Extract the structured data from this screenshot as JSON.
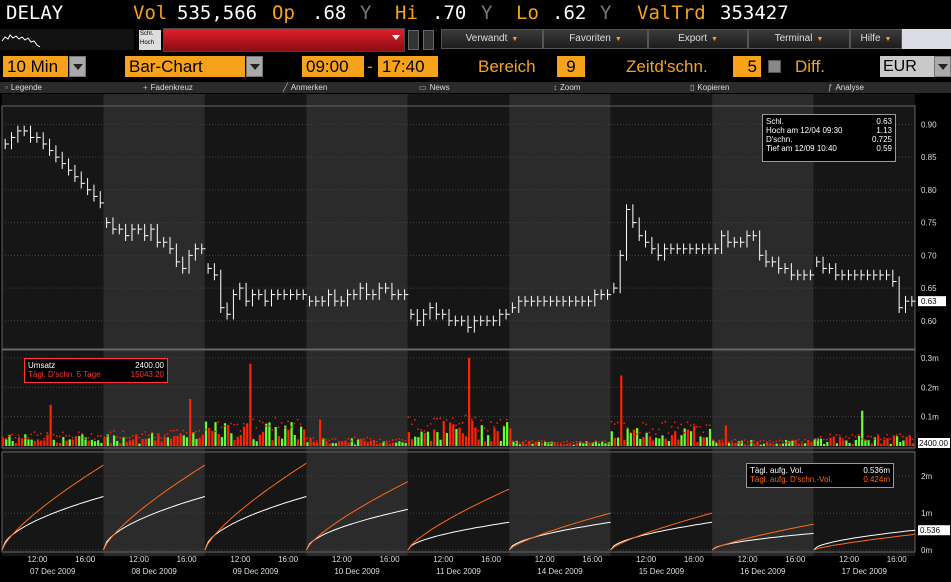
{
  "ticker": {
    "symbol": "DELAY",
    "vol_label": "Vol",
    "vol": "535,566",
    "op_label": "Op",
    "op": ".68",
    "op_flag": "Y",
    "hi_label": "Hi",
    "hi": ".70",
    "hi_flag": "Y",
    "lo_label": "Lo",
    "lo": ".62",
    "lo_flag": "Y",
    "valtrd_label": "ValTrd",
    "valtrd": "353427"
  },
  "menu": {
    "mini_box": [
      "Schl.",
      "Hoch"
    ],
    "items": [
      {
        "label": "Verwandt"
      },
      {
        "label": "Favoriten"
      },
      {
        "label": "Export"
      },
      {
        "label": "Terminal"
      },
      {
        "label": "Hilfe"
      }
    ]
  },
  "controls": {
    "interval": "10 Min",
    "chart_type": "Bar-Chart",
    "time_from": "09:00",
    "time_sep": "-",
    "time_to": "17:40",
    "bereich_label": "Bereich",
    "bereich": "9",
    "zeitd_label": "Zeitd'schn.",
    "zeitd": "5",
    "diff_label": "Diff.",
    "currency": "EUR"
  },
  "toolbar": [
    {
      "label": "Legende",
      "icon": "square-icon"
    },
    {
      "label": "Fadenkreuz",
      "icon": "crosshair-icon"
    },
    {
      "label": "Anmerken",
      "icon": "pencil-icon"
    },
    {
      "label": "News",
      "icon": "document-icon"
    },
    {
      "label": "Zoom",
      "icon": "arrows-icon"
    },
    {
      "label": "Kopieren",
      "icon": "copy-icon"
    },
    {
      "label": "Analyse",
      "icon": "function-icon"
    }
  ],
  "price_legend": [
    {
      "label": "Schl.",
      "value": "0.63"
    },
    {
      "label": "Hoch am  12/04 09:30",
      "value": "1.13"
    },
    {
      "label": "D'schn.",
      "value": "0.725"
    },
    {
      "label": "Tief am  12/09 10:40",
      "value": "0.59"
    }
  ],
  "volume_legend": [
    {
      "label": "Umsatz",
      "value": "2400.00"
    },
    {
      "label": "Tägl. D'schn. 5 Tage",
      "value": "15043.20"
    }
  ],
  "cum_legend": [
    {
      "label": "Tägl. aufg. Vol.",
      "value": "0.536m"
    },
    {
      "label": "Tägl. aufg. D'schn.-Vol.",
      "value": "0.424m"
    }
  ],
  "colors": {
    "accent": "#f7a21b",
    "bg": "#000000",
    "price_line": "#ffffff",
    "vol_up": "#66ff33",
    "vol_down": "#ff2200",
    "avg_line": "#ff6a1a"
  },
  "chart_data": [
    {
      "type": "bar",
      "panel": "price",
      "y_ticks": [
        "0.90",
        "0.85",
        "0.80",
        "0.75",
        "0.70",
        "0.65",
        "0.60"
      ],
      "ylim": [
        0.56,
        0.925
      ],
      "last_value_label": "0.63",
      "days": [
        "07 Dec 2009",
        "08 Dec 2009",
        "09 Dec 2009",
        "10 Dec 2009",
        "11 Dec 2009",
        "14 Dec 2009",
        "15 Dec 2009",
        "16 Dec 2009",
        "17 Dec 2009"
      ],
      "x_tick_labels": [
        "12:00",
        "16:00"
      ],
      "close_by_day": [
        [
          0.87,
          0.88,
          0.89,
          0.89,
          0.88,
          0.88,
          0.87,
          0.86,
          0.85,
          0.84,
          0.83,
          0.82,
          0.81,
          0.8,
          0.79,
          0.78
        ],
        [
          0.75,
          0.74,
          0.74,
          0.73,
          0.74,
          0.74,
          0.73,
          0.74,
          0.72,
          0.72,
          0.71,
          0.69,
          0.68,
          0.7,
          0.71,
          0.71
        ],
        [
          0.68,
          0.67,
          0.62,
          0.61,
          0.64,
          0.65,
          0.63,
          0.64,
          0.64,
          0.63,
          0.64,
          0.64,
          0.64,
          0.64,
          0.64,
          0.64
        ],
        [
          0.63,
          0.63,
          0.63,
          0.64,
          0.63,
          0.63,
          0.64,
          0.64,
          0.65,
          0.64,
          0.64,
          0.65,
          0.65,
          0.64,
          0.64,
          0.64
        ],
        [
          0.61,
          0.6,
          0.61,
          0.62,
          0.61,
          0.61,
          0.6,
          0.6,
          0.6,
          0.59,
          0.6,
          0.6,
          0.6,
          0.6,
          0.61,
          0.61
        ],
        [
          0.62,
          0.63,
          0.63,
          0.63,
          0.63,
          0.63,
          0.63,
          0.63,
          0.63,
          0.63,
          0.63,
          0.63,
          0.63,
          0.64,
          0.64,
          0.64
        ],
        [
          0.65,
          0.7,
          0.77,
          0.75,
          0.73,
          0.72,
          0.71,
          0.7,
          0.71,
          0.71,
          0.71,
          0.71,
          0.71,
          0.71,
          0.71,
          0.71
        ],
        [
          0.71,
          0.73,
          0.72,
          0.72,
          0.72,
          0.73,
          0.73,
          0.7,
          0.69,
          0.69,
          0.68,
          0.68,
          0.67,
          0.67,
          0.67,
          0.67
        ],
        [
          0.69,
          0.68,
          0.68,
          0.67,
          0.67,
          0.67,
          0.67,
          0.67,
          0.67,
          0.67,
          0.67,
          0.67,
          0.66,
          0.62,
          0.63,
          0.63
        ]
      ]
    },
    {
      "type": "bar",
      "panel": "volume",
      "y_ticks": [
        "0.3m",
        "0.2m",
        "0.1m"
      ],
      "ylim": [
        0,
        320000
      ],
      "last_value_label": "2400.00",
      "days": [
        "07 Dec 2009",
        "08 Dec 2009",
        "09 Dec 2009",
        "10 Dec 2009",
        "11 Dec 2009",
        "14 Dec 2009",
        "15 Dec 2009",
        "16 Dec 2009",
        "17 Dec 2009"
      ],
      "peak_by_day": [
        140000,
        160000,
        280000,
        90000,
        300000,
        60000,
        240000,
        70000,
        120000
      ]
    },
    {
      "type": "line",
      "panel": "cumulative",
      "y_ticks": [
        "2m",
        "1m",
        "0m"
      ],
      "ylim": [
        0,
        2600000
      ],
      "last_value_label": "0.536",
      "days": [
        "07 Dec 2009",
        "08 Dec 2009",
        "09 Dec 2009",
        "10 Dec 2009",
        "11 Dec 2009",
        "14 Dec 2009",
        "15 Dec 2009",
        "16 Dec 2009",
        "17 Dec 2009"
      ],
      "series": [
        {
          "name": "Tägl. aufg. Vol.",
          "end_by_day": [
            1450000,
            1450000,
            1450000,
            1100000,
            750000,
            750000,
            750000,
            450000,
            536000
          ]
        },
        {
          "name": "Tägl. aufg. D'schn.-Vol.",
          "end_by_day": [
            2300000,
            2300000,
            2350000,
            1850000,
            1650000,
            1000000,
            1000000,
            700000,
            424000
          ]
        }
      ]
    }
  ]
}
